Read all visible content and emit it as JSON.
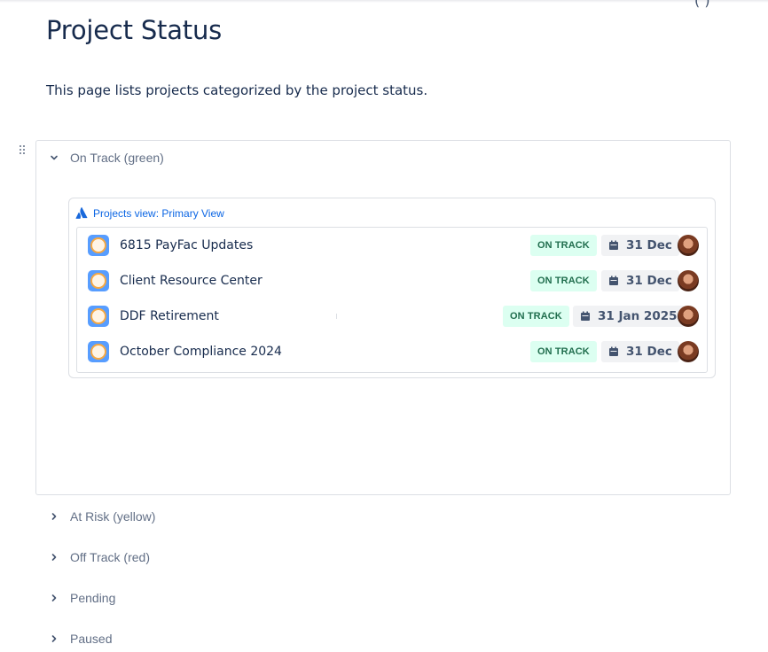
{
  "page": {
    "title": "Project Status",
    "description": "This page lists projects categorized by the project status.",
    "corner_glyph": "( )"
  },
  "expands": [
    {
      "label": "On Track (green)",
      "expanded": true
    },
    {
      "label": "At Risk (yellow)",
      "expanded": false
    },
    {
      "label": "Off Track (red)",
      "expanded": false
    },
    {
      "label": "Pending",
      "expanded": false
    },
    {
      "label": "Paused",
      "expanded": false
    }
  ],
  "embed": {
    "title": "Projects view: Primary View",
    "logo_icon": "atlassian-logo-icon",
    "projects": [
      {
        "name": "6815 PayFac Updates",
        "status": "ON TRACK",
        "date": "31 Dec"
      },
      {
        "name": "Client Resource Center",
        "status": "ON TRACK",
        "date": "31 Dec"
      },
      {
        "name": "DDF Retirement",
        "status": "ON TRACK",
        "date": "31 Jan 2025"
      },
      {
        "name": "October Compliance 2024",
        "status": "ON TRACK",
        "date": "31 Dec"
      }
    ]
  },
  "colors": {
    "link": "#0c66e4",
    "on_track_bg": "#dcfff1",
    "on_track_text": "#216e4e",
    "project_icon_bg": "#579dff"
  },
  "icons": {
    "project": "compass-icon",
    "date": "calendar-icon",
    "expand_open": "chevron-down-icon",
    "expand_closed": "chevron-right-icon",
    "drag": "drag-handle-icon"
  }
}
